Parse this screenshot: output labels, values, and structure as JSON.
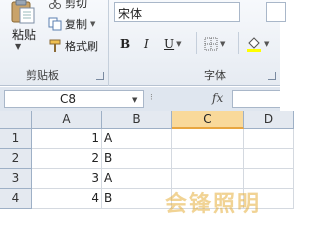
{
  "ribbon": {
    "clipboard": {
      "paste_label": "粘贴",
      "cut_label": "剪切",
      "copy_label": "复制",
      "format_painter_label": "格式刷",
      "group_label": "剪贴板"
    },
    "font": {
      "font_name": "宋体",
      "group_label": "字体",
      "bold_label": "B",
      "italic_label": "I",
      "underline_label": "U"
    }
  },
  "formula_bar": {
    "name_box": "C8",
    "fx_label": "fx",
    "formula": ""
  },
  "columns": [
    "A",
    "B",
    "C",
    "D"
  ],
  "active_column": "C",
  "rows": [
    {
      "header": "1",
      "a": "1",
      "b": "A"
    },
    {
      "header": "2",
      "a": "2",
      "b": "B"
    },
    {
      "header": "3",
      "a": "3",
      "b": "A"
    },
    {
      "header": "4",
      "a": "4",
      "b": "B"
    }
  ],
  "watermark": "会锋照明"
}
